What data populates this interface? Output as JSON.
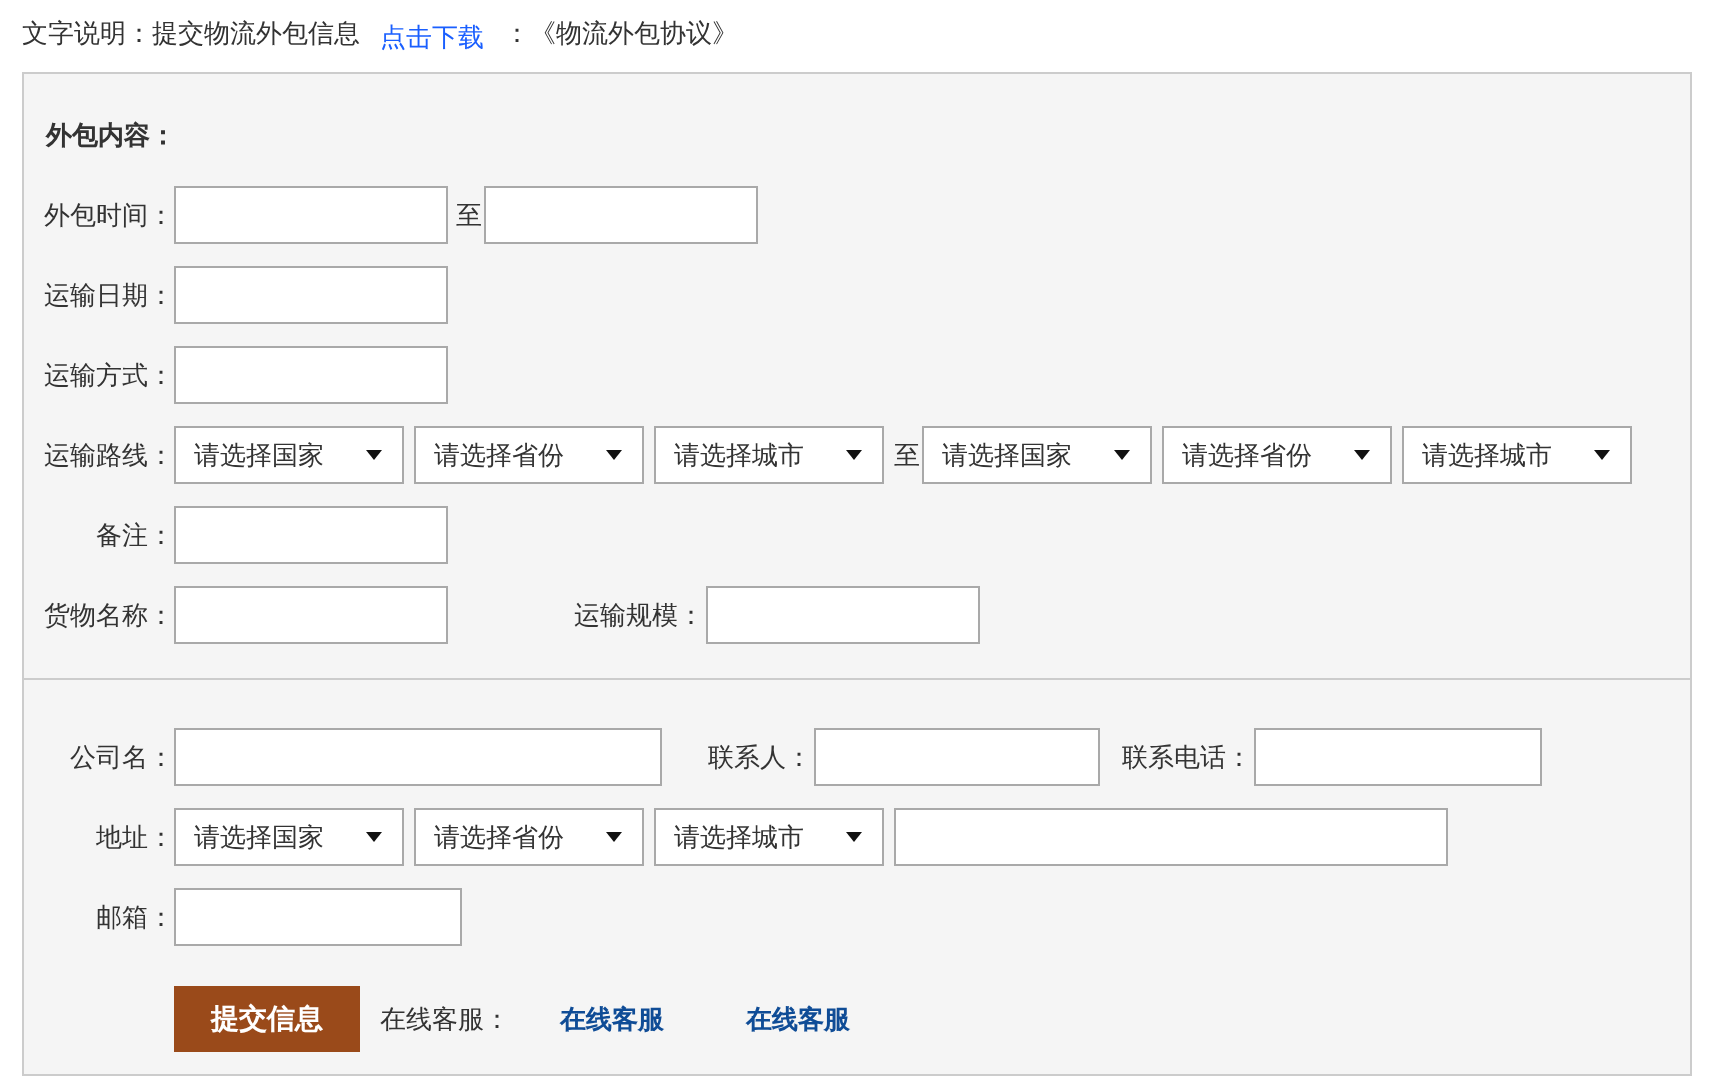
{
  "intro": {
    "label": "文字说明：提交物流外包信息",
    "link": "点击下载",
    "after": "：《物流外包协议》"
  },
  "sections": [
    {
      "heading": "外包内容：",
      "rows": [
        {
          "label": "外包时间：",
          "fields": [
            {
              "kind": "input"
            },
            {
              "kind": "text",
              "text": "至"
            },
            {
              "kind": "input"
            }
          ]
        },
        {
          "label": "运输日期：",
          "fields": [
            {
              "kind": "input"
            }
          ]
        },
        {
          "label": "运输方式：",
          "fields": [
            {
              "kind": "input"
            }
          ]
        },
        {
          "label": "运输路线：",
          "fields": [
            {
              "kind": "select",
              "value": "请选择国家"
            },
            {
              "kind": "select",
              "value": "请选择省份"
            },
            {
              "kind": "select",
              "value": "请选择城市"
            },
            {
              "kind": "text",
              "text": "至"
            },
            {
              "kind": "select",
              "value": "请选择国家"
            },
            {
              "kind": "select",
              "value": "请选择省份"
            },
            {
              "kind": "select",
              "value": "请选择城市"
            }
          ]
        },
        {
          "label": "备注：",
          "fields": [
            {
              "kind": "input"
            }
          ]
        },
        {
          "label": "货物名称：",
          "fields": [
            {
              "kind": "input"
            },
            {
              "kind": "text",
              "text": "运输规模："
            },
            {
              "kind": "input"
            }
          ]
        }
      ]
    },
    {
      "rows": [
        {
          "label": "公司名：",
          "fields": [
            {
              "kind": "input"
            },
            {
              "kind": "text",
              "text": "联系人："
            },
            {
              "kind": "input"
            },
            {
              "kind": "text",
              "text": "联系电话："
            },
            {
              "kind": "input"
            }
          ]
        },
        {
          "label": "地址：",
          "fields": [
            {
              "kind": "select",
              "value": "请选择国家"
            },
            {
              "kind": "select",
              "value": "请选择省份"
            },
            {
              "kind": "select",
              "value": "请选择城市"
            },
            {
              "kind": "input"
            }
          ]
        },
        {
          "label": "邮箱：",
          "fields": [
            {
              "kind": "input"
            }
          ]
        }
      ]
    }
  ],
  "submit": {
    "button": "提交信息",
    "service_label": "在线客服：",
    "service_links": [
      "在线客服",
      "在线客服"
    ]
  }
}
